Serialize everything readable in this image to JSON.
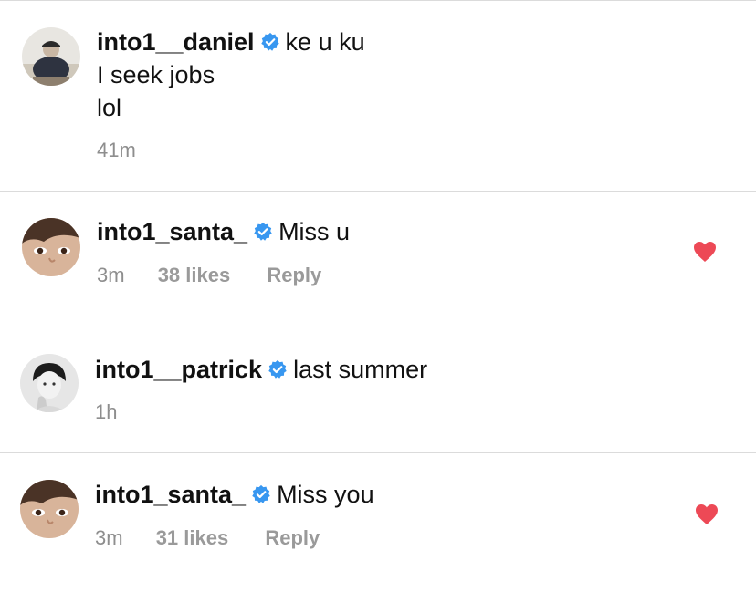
{
  "comments": [
    {
      "username": "into1__daniel",
      "text": "ke u ku",
      "extra_lines": [
        "I seek jobs",
        "lol"
      ],
      "time": "41m",
      "likes": "",
      "reply": "",
      "liked": false,
      "verified_icon": "verified-badge-icon"
    },
    {
      "username": "into1_santa_",
      "text": "Miss u",
      "extra_lines": [],
      "time": "3m",
      "likes": "38 likes",
      "reply": "Reply",
      "liked": true,
      "verified_icon": "verified-badge-icon"
    },
    {
      "username": "into1__patrick",
      "text": "last summer",
      "extra_lines": [],
      "time": "1h",
      "likes": "",
      "reply": "",
      "liked": false,
      "verified_icon": "verified-badge-icon"
    },
    {
      "username": "into1_santa_",
      "text": "Miss you",
      "extra_lines": [],
      "time": "3m",
      "likes": "31 likes",
      "reply": "Reply",
      "liked": true,
      "verified_icon": "verified-badge-icon"
    }
  ],
  "colors": {
    "verified": "#3897f0",
    "heart": "#ed4956",
    "meta_text": "#8e8e8e",
    "divider": "#dbdbdb"
  }
}
